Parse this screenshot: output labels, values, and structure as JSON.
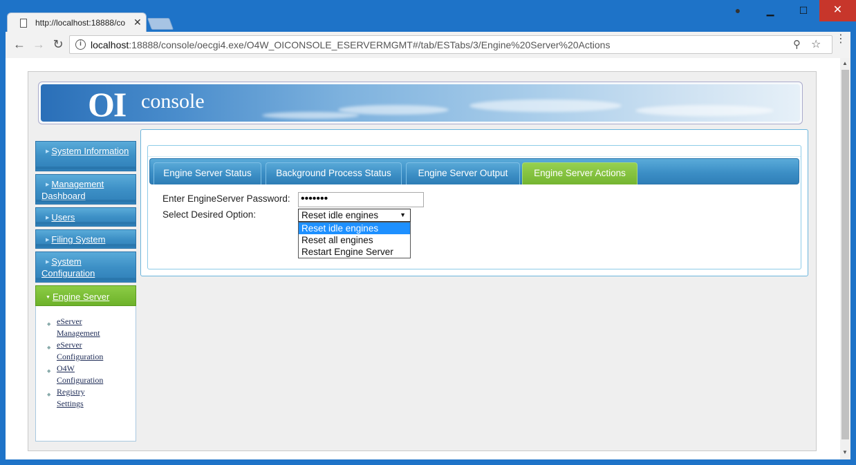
{
  "browser": {
    "tab_title": "http://localhost:18888/co",
    "url_host": "localhost",
    "url_rest": ":18888/console/oecgi4.exe/O4W_OICONSOLE_ESERVERMGMT#/tab/ESTabs/3/Engine%20Server%20Actions"
  },
  "banner": {
    "logo_primary": "OI",
    "logo_secondary": "console"
  },
  "sidebar": {
    "items": [
      {
        "label": "System Information"
      },
      {
        "label": "Management Dashboard"
      },
      {
        "label": "Users"
      },
      {
        "label": "Filing System"
      },
      {
        "label": "System Configuration"
      },
      {
        "label": "Engine Server"
      }
    ],
    "sub_items": [
      {
        "label": "eServer Management"
      },
      {
        "label": "eServer Configuration"
      },
      {
        "label": "O4W Configuration"
      },
      {
        "label": "Registry Settings"
      }
    ]
  },
  "tabs": [
    {
      "label": "Engine Server Status"
    },
    {
      "label": "Background Process Status"
    },
    {
      "label": "Engine Server Output"
    },
    {
      "label": "Engine Server Actions"
    }
  ],
  "form": {
    "password_label": "Enter EngineServer Password:",
    "password_value": "•••••••",
    "option_label": "Select Desired Option:",
    "selected_option": "Reset idle engines",
    "options": [
      "Reset idle engines",
      "Reset all engines",
      "Restart Engine Server"
    ]
  },
  "colors": {
    "sidebar_blue": "#3d90c6",
    "active_green": "#74b531",
    "highlight": "#1e90ff",
    "close_red": "#c7362b"
  }
}
